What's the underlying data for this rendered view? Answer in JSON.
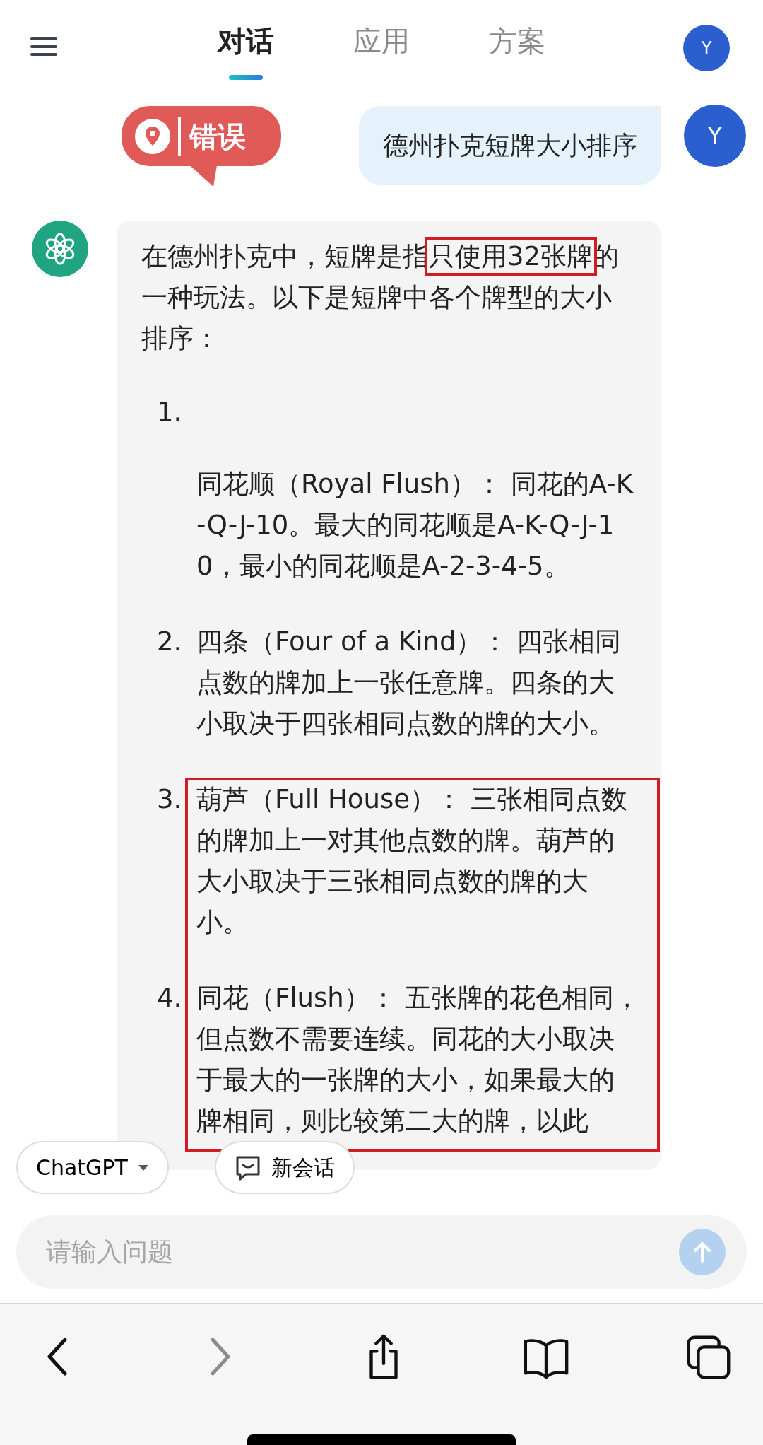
{
  "header": {
    "tabs": [
      {
        "label": "对话",
        "selected": true
      },
      {
        "label": "应用",
        "selected": false
      },
      {
        "label": "方案",
        "selected": false
      }
    ],
    "avatar": "Y"
  },
  "annotation": {
    "label": "错误"
  },
  "user_message": {
    "text": "德州扑克短牌大小排序",
    "avatar": "Y"
  },
  "assistant_message": {
    "intro": {
      "before": "在德州扑克中，短牌是指",
      "highlighted": "只使用32张牌",
      "after": "的一种玩法。以下是短牌中各个牌型的大小排序："
    },
    "items": [
      {
        "number": "1.",
        "text": "同花顺（Royal Flush）： 同花的A-K-Q-J-10。最大的同花顺是A-K-Q-J-10，最小的同花顺是A-2-3-4-5。",
        "number_on_own_line": true,
        "highlighted": false
      },
      {
        "number": "2.",
        "text": "四条（Four of a Kind）： 四张相同点数的牌加上一张任意牌。四条的大小取决于四张相同点数的牌的大小。",
        "number_on_own_line": false,
        "highlighted": false
      },
      {
        "number": "3.",
        "text": "葫芦（Full House）： 三张相同点数的牌加上一对其他点数的牌。葫芦的大小取决于三张相同点数的牌的大小。",
        "number_on_own_line": false,
        "highlighted": true
      },
      {
        "number": "4.",
        "text": "同花（Flush）： 五张牌的花色相同，但点数不需要连续。同花的大小取决于最大的一张牌的大小，如果最大的牌相同，则比较第二大的牌，以此",
        "number_on_own_line": false,
        "highlighted": true
      }
    ]
  },
  "floating_buttons": {
    "model": "ChatGPT",
    "new_chat": "新会话"
  },
  "input": {
    "placeholder": "请输入问题"
  },
  "send_button": {
    "disabled": true
  },
  "browser_toolbar": [
    {
      "kind": "back",
      "disabled": false
    },
    {
      "kind": "forward",
      "disabled": true
    },
    {
      "kind": "share",
      "disabled": false
    },
    {
      "kind": "bookmarks",
      "disabled": false
    },
    {
      "kind": "tabs",
      "disabled": false
    }
  ]
}
